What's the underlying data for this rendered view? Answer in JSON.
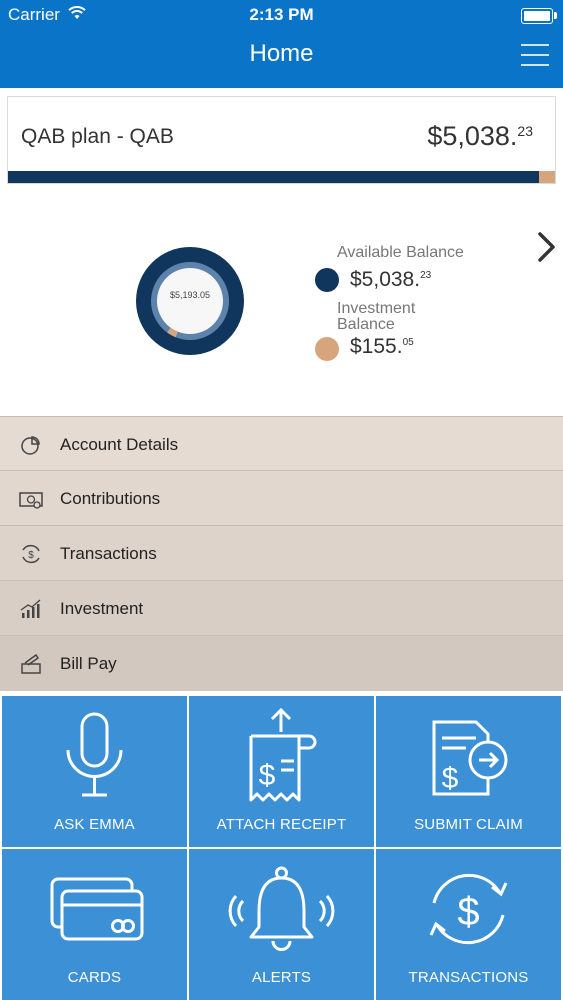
{
  "status_bar": {
    "carrier": "Carrier",
    "time": "2:13 PM"
  },
  "nav": {
    "title": "Home"
  },
  "plan": {
    "name": "QAB plan - QAB",
    "amount_main": "$5,038.",
    "amount_cents": "23"
  },
  "summary": {
    "donut_center_text": "$5,193.05",
    "available": {
      "label": "Available Balance",
      "main": "$5,038.",
      "cents": "23",
      "value": 5038.23,
      "color": "#10365e"
    },
    "investment": {
      "label_line1": "Investment",
      "label_line2": "Balance",
      "main": "$155.",
      "cents": "05",
      "value": 155.05,
      "color": "#d7a57d"
    }
  },
  "menu": {
    "items": [
      {
        "label": "Account Details",
        "icon": "pie-chart-icon",
        "bg": "#e6dbd2"
      },
      {
        "label": "Contributions",
        "icon": "cash-icon",
        "bg": "#e2d7ce"
      },
      {
        "label": "Transactions",
        "icon": "dollar-cycle-icon",
        "bg": "#ddd3ca"
      },
      {
        "label": "Investment",
        "icon": "growth-chart-icon",
        "bg": "#d8cec5"
      },
      {
        "label": "Bill Pay",
        "icon": "bill-pay-icon",
        "bg": "#d3c8bf"
      }
    ]
  },
  "tiles": [
    {
      "label": "ASK EMMA",
      "icon": "microphone-icon"
    },
    {
      "label": "ATTACH RECEIPT",
      "icon": "receipt-icon"
    },
    {
      "label": "SUBMIT CLAIM",
      "icon": "claim-icon"
    },
    {
      "label": "CARDS",
      "icon": "cards-icon"
    },
    {
      "label": "ALERTS",
      "icon": "bell-icon"
    },
    {
      "label": "TRANSACTIONS",
      "icon": "transactions-icon"
    }
  ]
}
